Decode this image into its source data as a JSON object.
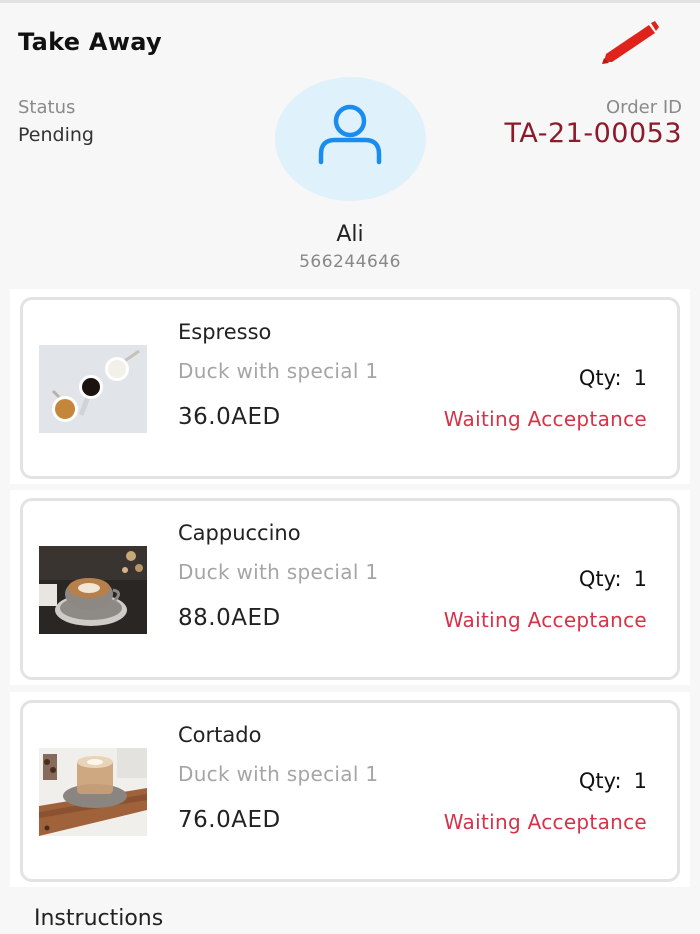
{
  "header": {
    "title": "Take Away"
  },
  "order": {
    "status_label": "Status",
    "status_value": "Pending",
    "id_label": "Order ID",
    "id_value": "TA-21-00053"
  },
  "customer": {
    "name": "Ali",
    "phone": "566244646"
  },
  "items": [
    {
      "name": "Espresso",
      "description": "Duck with special 1",
      "price": "36.0AED",
      "qty_label": "Qty:",
      "qty_value": "1",
      "status": "Waiting Acceptance"
    },
    {
      "name": "Cappuccino",
      "description": "Duck with special 1",
      "price": "88.0AED",
      "qty_label": "Qty:",
      "qty_value": "1",
      "status": "Waiting Acceptance"
    },
    {
      "name": "Cortado",
      "description": "Duck with special 1",
      "price": "76.0AED",
      "qty_label": "Qty:",
      "qty_value": "1",
      "status": "Waiting Acceptance"
    }
  ],
  "instructions_label": "Instructions",
  "icons": {
    "edit": "pencil-icon",
    "avatar": "user-icon"
  },
  "colors": {
    "order_id": "#8b1a2b",
    "status_waiting": "#d83248",
    "edit_icon": "#e0231a",
    "avatar_bg": "#dff1fb",
    "avatar_icon": "#1a8cf0"
  }
}
